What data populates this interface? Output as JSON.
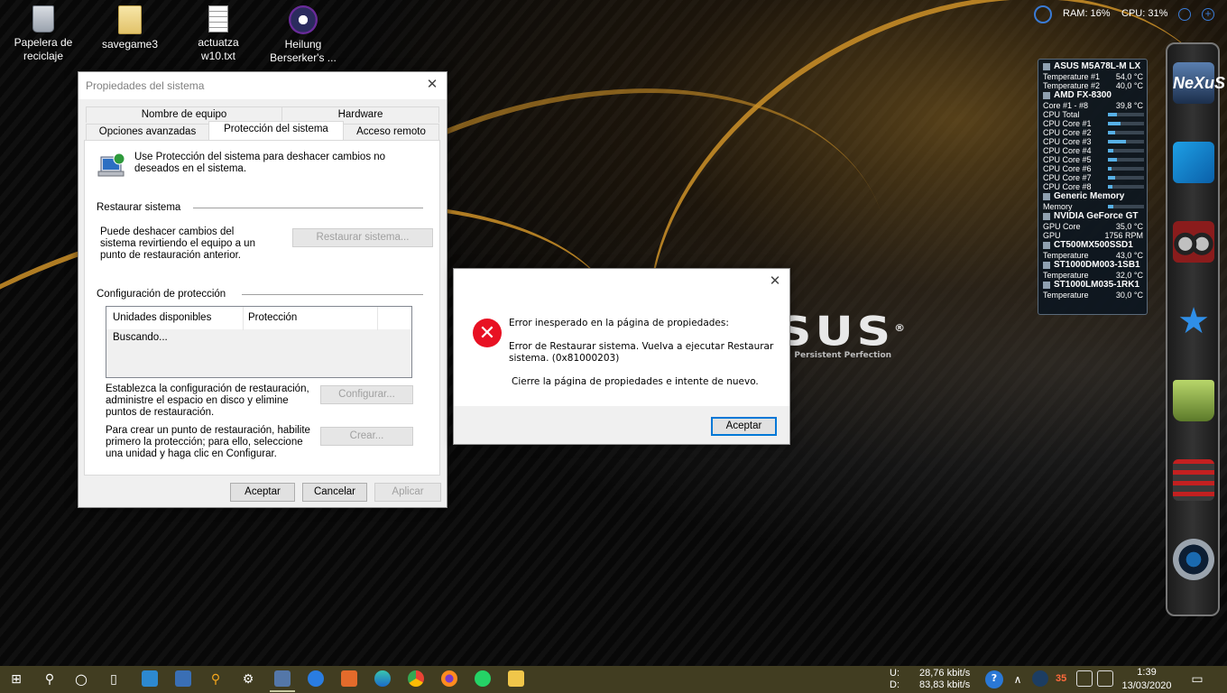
{
  "desktop": {
    "icons": [
      {
        "label": "Papelera de reciclaje",
        "icon": "recycle-bin-icon"
      },
      {
        "label": "savegame3",
        "icon": "folder-icon"
      },
      {
        "label": "actuatza w10.txt",
        "icon": "text-file-icon"
      },
      {
        "label": "Heilung Berserker's  ...",
        "icon": "media-file-icon"
      }
    ],
    "wallpaper_brand": "SUS",
    "wallpaper_registered": "®",
    "wallpaper_tagline": "n • Persistent Perfection"
  },
  "sysmon": {
    "ram": "RAM: 16%",
    "cpu": "CPU: 31%",
    "plus": "+"
  },
  "hwmonitor": {
    "sections": [
      {
        "name": "ASUS M5A78L-M LX",
        "rows": [
          {
            "label": "Temperature #1",
            "value": "54,0 °C"
          },
          {
            "label": "Temperature #2",
            "value": "40,0 °C"
          }
        ]
      },
      {
        "name": "AMD FX-8300",
        "rows": [
          {
            "label": "Core #1 - #8",
            "value": "39,8 °C"
          },
          {
            "label": "CPU Total",
            "bar": 0.25
          },
          {
            "label": "CPU Core #1",
            "bar": 0.35
          },
          {
            "label": "CPU Core #2",
            "bar": 0.2
          },
          {
            "label": "CPU Core #3",
            "bar": 0.5
          },
          {
            "label": "CPU Core #4",
            "bar": 0.15
          },
          {
            "label": "CPU Core #5",
            "bar": 0.25
          },
          {
            "label": "CPU Core #6",
            "bar": 0.1
          },
          {
            "label": "CPU Core #7",
            "bar": 0.2
          },
          {
            "label": "CPU Core #8",
            "bar": 0.12
          }
        ]
      },
      {
        "name": "Generic Memory",
        "rows": [
          {
            "label": "Memory",
            "bar": 0.16
          }
        ]
      },
      {
        "name": "NVIDIA GeForce GT",
        "rows": [
          {
            "label": "GPU Core",
            "value": "35,0 °C"
          },
          {
            "label": "GPU",
            "value": "1756 RPM"
          }
        ]
      },
      {
        "name": "CT500MX500SSD1",
        "rows": [
          {
            "label": "Temperature",
            "value": "43,0 °C"
          }
        ]
      },
      {
        "name": "ST1000DM003-1SB1",
        "rows": [
          {
            "label": "Temperature",
            "value": "32,0 °C"
          }
        ]
      },
      {
        "name": "ST1000LM035-1RK1",
        "rows": [
          {
            "label": "Temperature",
            "value": "30,0 °C"
          }
        ]
      }
    ]
  },
  "dock": {
    "logo": "NeXuS",
    "items": [
      "nexus-logo-icon",
      "windows-icon",
      "binoculars-icon",
      "star-icon",
      "bag-icon",
      "stacked-box-icon",
      "camera-icon"
    ]
  },
  "props": {
    "title": "Propiedades del sistema",
    "tabs_row1": [
      "Nombre de equipo",
      "Hardware"
    ],
    "tabs_row2": [
      "Opciones avanzadas",
      "Protección del sistema",
      "Acceso remoto"
    ],
    "intro": "Use Protección del sistema para deshacer cambios no deseados en el sistema.",
    "restore_section": "Restaurar sistema",
    "restore_text": "Puede deshacer cambios del sistema revirtiendo el equipo a un punto de restauración anterior.",
    "restore_button": "Restaurar sistema...",
    "config_section": "Configuración de protección",
    "col_drives": "Unidades disponibles",
    "col_protection": "Protección",
    "searching": "Buscando...",
    "config_text": "Establezca la configuración de restauración, administre el espacio en disco y elimine puntos de restauración.",
    "config_button": "Configurar...",
    "create_text": "Para crear un punto de restauración, habilite primero la protección; para ello, seleccione una unidad y haga clic en Configurar.",
    "create_button": "Crear...",
    "ok": "Aceptar",
    "cancel": "Cancelar",
    "apply": "Aplicar"
  },
  "error": {
    "line1": "Error inesperado en la página de propiedades:",
    "line2": "Error de Restaurar sistema. Vuelva a ejecutar Restaurar sistema. (0x81000203)",
    "line3": "Cierre la página de propiedades e intente de nuevo.",
    "ok": "Aceptar"
  },
  "taskbar": {
    "net_u_label": "U:",
    "net_d_label": "D:",
    "net_u": "28,76 kbit/s",
    "net_d": "83,83 kbit/s",
    "tray_number": "35",
    "time": "1:39",
    "date": "13/03/2020",
    "accent": "#413d21"
  }
}
